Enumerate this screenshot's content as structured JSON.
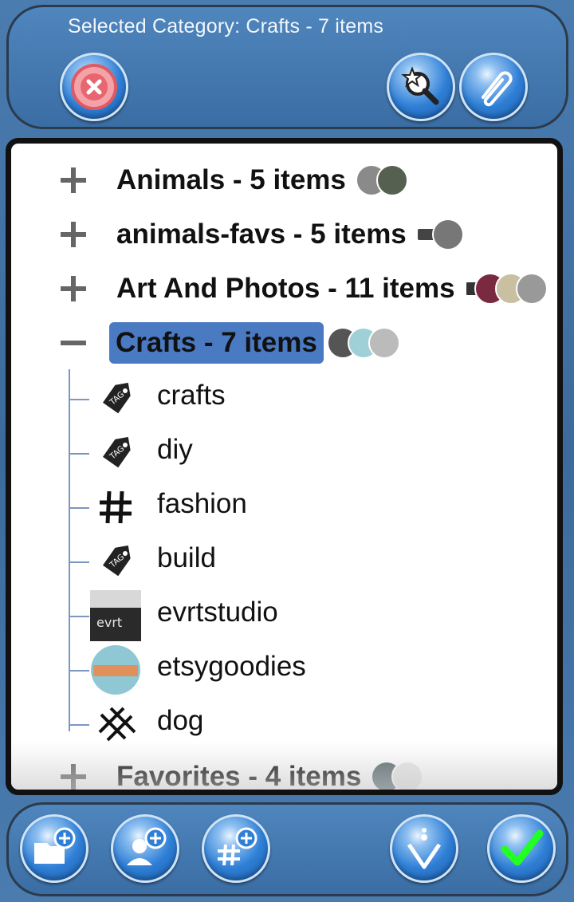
{
  "header": {
    "title": "Selected Category: Crafts - 7 items",
    "buttons": {
      "close": "close-icon",
      "search": "search-star-icon",
      "attach": "paperclip-icon"
    }
  },
  "tree": {
    "categories": [
      {
        "label": "Animals - 5 items",
        "expanded": false
      },
      {
        "label": "animals-favs - 5 items",
        "expanded": false
      },
      {
        "label": "Art And Photos - 11 items",
        "expanded": false
      },
      {
        "label": "Crafts - 7 items",
        "expanded": true,
        "selected": true
      },
      {
        "label": "Favorites - 4 items",
        "expanded": false
      }
    ],
    "crafts_children": [
      {
        "label": "crafts",
        "icon": "tag-icon"
      },
      {
        "label": "diy",
        "icon": "tag-icon"
      },
      {
        "label": "fashion",
        "icon": "hashtag-icon"
      },
      {
        "label": "build",
        "icon": "tag-icon"
      },
      {
        "label": "evrtstudio",
        "icon": "user-thumbnail-icon"
      },
      {
        "label": "etsygoodies",
        "icon": "user-thumbnail-icon"
      },
      {
        "label": "dog",
        "icon": "hashtag-icon"
      }
    ]
  },
  "footer": {
    "buttons": [
      "add-folder-icon",
      "add-user-icon",
      "add-hashtag-icon",
      "sort-icon",
      "checkmark-icon"
    ]
  },
  "colors": {
    "background": "#3f6e9e",
    "selection": "#4a7ac2",
    "tree_line": "#7c96c4"
  }
}
